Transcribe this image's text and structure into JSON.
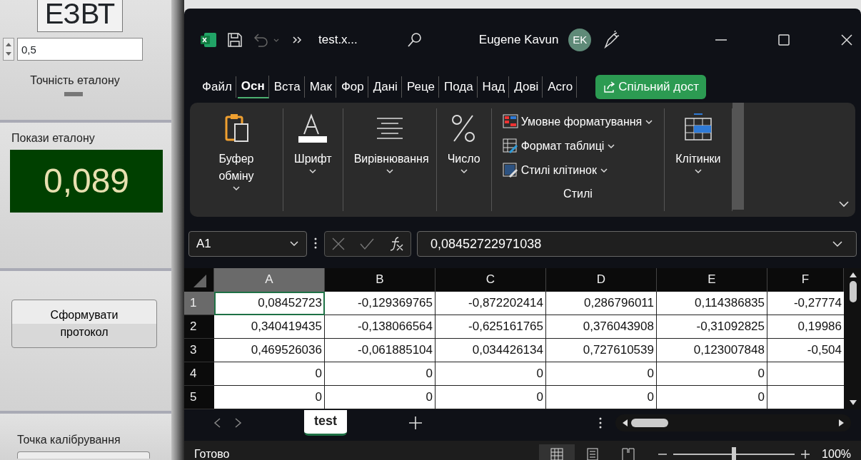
{
  "left_panel": {
    "top_label": "ЕЗВТ",
    "accuracy": {
      "value": "0,5",
      "label": "Точність еталону"
    },
    "reading": {
      "label": "Покази еталону",
      "value": "0,089"
    },
    "protocol_button": "Сформувати протокол",
    "calibration_point": {
      "label": "Точка калібрування"
    }
  },
  "excel": {
    "title_bar": {
      "file_name": "test.x...",
      "user": "Eugene Kavun",
      "avatar": "EK"
    },
    "ribbon_tabs": [
      {
        "label": "Файл",
        "selected": false
      },
      {
        "label": "Осн",
        "selected": true
      },
      {
        "label": "Вста",
        "selected": false
      },
      {
        "label": "Мак",
        "selected": false
      },
      {
        "label": "Фор",
        "selected": false
      },
      {
        "label": "Дані",
        "selected": false
      },
      {
        "label": "Реце",
        "selected": false
      },
      {
        "label": "Пода",
        "selected": false
      },
      {
        "label": "Над",
        "selected": false
      },
      {
        "label": "Дові",
        "selected": false
      },
      {
        "label": "Acro",
        "selected": false
      }
    ],
    "share_button": "Спільний дост",
    "ribbon_groups": [
      {
        "kind": "large",
        "label": "Буфер обміну"
      },
      {
        "kind": "large",
        "label": "Шрифт"
      },
      {
        "kind": "large",
        "label": "Вирівнювання"
      },
      {
        "kind": "large",
        "label": "Число"
      },
      {
        "kind": "styles",
        "label": "Стилі",
        "items": [
          {
            "label": "Умовне форматування"
          },
          {
            "label": "Формат таблиці"
          },
          {
            "label": "Стилі клітинок"
          }
        ]
      },
      {
        "kind": "large",
        "label": "Клітинки"
      }
    ],
    "formula_bar": {
      "name_box": "A1",
      "formula": "0,08452722971038"
    },
    "columns": [
      {
        "label": "A",
        "selected": true
      },
      {
        "label": "B",
        "selected": false
      },
      {
        "label": "C",
        "selected": false
      },
      {
        "label": "D",
        "selected": false
      },
      {
        "label": "E",
        "selected": false
      },
      {
        "label": "F",
        "selected": false
      }
    ],
    "rows": [
      {
        "header": "1",
        "selected": true,
        "cells": [
          "0,08452723",
          "-0,129369765",
          "-0,872202414",
          "0,286796011",
          "0,114386835",
          "-0,27774"
        ]
      },
      {
        "header": "2",
        "selected": false,
        "cells": [
          "0,340419435",
          "-0,138066564",
          "-0,625161765",
          "0,376043908",
          "-0,31092825",
          "0,19986"
        ]
      },
      {
        "header": "3",
        "selected": false,
        "cells": [
          "0,469526036",
          "-0,061885104",
          "0,034426134",
          "0,727610539",
          "0,123007848",
          "-0,504"
        ]
      },
      {
        "header": "4",
        "selected": false,
        "cells": [
          "0",
          "0",
          "0",
          "0",
          "0",
          ""
        ]
      },
      {
        "header": "5",
        "selected": false,
        "cells": [
          "0",
          "0",
          "0",
          "0",
          "0",
          ""
        ]
      }
    ],
    "sheet_tabs": [
      {
        "label": "test",
        "selected": true
      }
    ],
    "status_bar": {
      "status": "Готово",
      "views": [
        {
          "kind": "normal",
          "selected": true
        },
        {
          "kind": "layout",
          "selected": false
        },
        {
          "kind": "pagebreak",
          "selected": false
        }
      ],
      "zoom": {
        "level": 0.5,
        "reading": "100%"
      }
    }
  }
}
